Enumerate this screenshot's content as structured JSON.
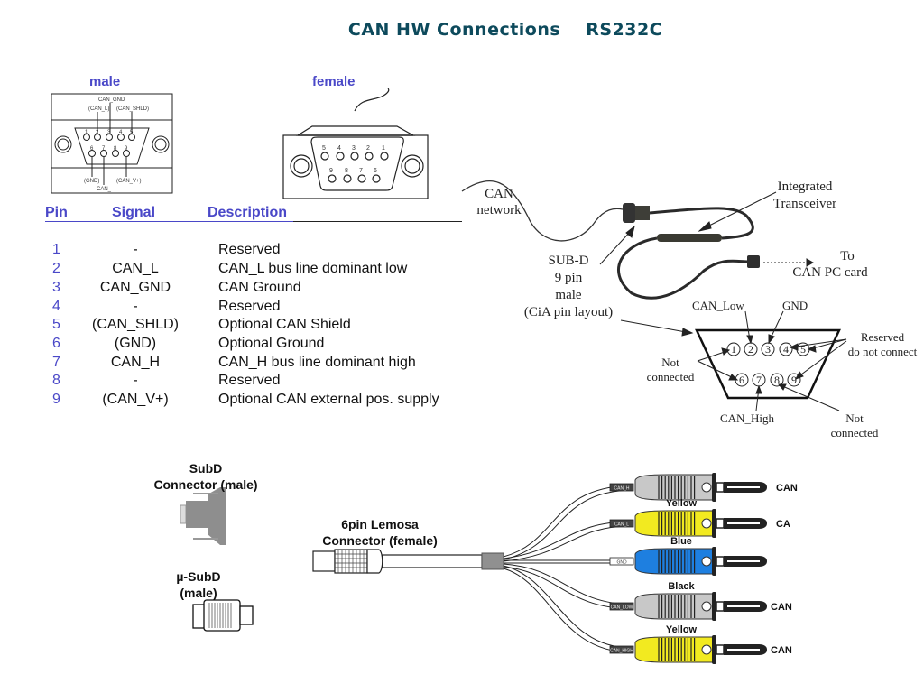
{
  "title": {
    "main": "CAN HW Connections",
    "sub": "RS232C"
  },
  "connectors": {
    "male": {
      "label": "male",
      "pin_labels_top": [
        "CAN_GND",
        "(CAN_L)",
        "(CAN_SHLD)"
      ],
      "pin_labels_bottom": [
        "(GND)",
        "CAN_",
        "(CAN_V+)"
      ],
      "pins_top": [
        "1",
        "2",
        "3",
        "4",
        "5"
      ],
      "pins_bottom": [
        "6",
        "7",
        "8",
        "9"
      ]
    },
    "female": {
      "label": "female",
      "pins_top": [
        "5",
        "4",
        "3",
        "2",
        "1"
      ],
      "pins_bottom": [
        "9",
        "8",
        "7",
        "6"
      ]
    }
  },
  "pin_table": {
    "headers": {
      "pin": "Pin",
      "signal": "Signal",
      "description": "Description"
    },
    "rows": [
      {
        "pin": "1",
        "signal": "-",
        "description": "Reserved"
      },
      {
        "pin": "2",
        "signal": "CAN_L",
        "description": "CAN_L bus line dominant low"
      },
      {
        "pin": "3",
        "signal": "CAN_GND",
        "description": "CAN Ground"
      },
      {
        "pin": "4",
        "signal": "-",
        "description": "Reserved"
      },
      {
        "pin": "5",
        "signal": "(CAN_SHLD)",
        "description": "Optional CAN Shield"
      },
      {
        "pin": "6",
        "signal": "(GND)",
        "description": "Optional Ground"
      },
      {
        "pin": "7",
        "signal": "CAN_H",
        "description": "CAN_H bus line dominant high"
      },
      {
        "pin": "8",
        "signal": "-",
        "description": "Reserved"
      },
      {
        "pin": "9",
        "signal": "(CAN_V+)",
        "description": "Optional CAN external pos. supply"
      }
    ]
  },
  "cable_diagram": {
    "can_network": [
      "CAN",
      "network"
    ],
    "integrated_transceiver": [
      "Integrated",
      "Transceiver"
    ],
    "to_pc": [
      "To",
      "CAN PC card"
    ],
    "subd": [
      "SUB-D",
      "9 pin",
      "male",
      "(CiA pin layout)"
    ],
    "can_low": "CAN_Low",
    "gnd": "GND",
    "reserved": [
      "Reserved",
      "do not connect"
    ],
    "not_connected_left": [
      "Not",
      "connected"
    ],
    "not_connected_right": [
      "Not",
      "connected"
    ],
    "can_high": "CAN_High",
    "pins_top": [
      "1",
      "2",
      "3",
      "4",
      "5"
    ],
    "pins_bottom": [
      "6",
      "7",
      "8",
      "9"
    ]
  },
  "adapters": {
    "subd": [
      "SubD",
      "Connector (male)"
    ],
    "micro_subd": [
      "µ-SubD",
      "(male)"
    ],
    "lemosa": [
      "6pin Lemosa",
      "Connector (female)"
    ]
  },
  "plugs": [
    {
      "color_label": "",
      "tag": "CAN_H",
      "end_label": "CAN",
      "color": "#c8c8c8"
    },
    {
      "color_label": "Yellow",
      "tag": "CAN_L",
      "end_label": "CA",
      "color": "#f2ea20"
    },
    {
      "color_label": "Blue",
      "tag": "GND",
      "end_label": "",
      "color": "#1e7fe0"
    },
    {
      "color_label": "Black",
      "tag": "CAN_LOW",
      "end_label": "CAN",
      "color": "#c8c8c8"
    },
    {
      "color_label": "Yellow",
      "tag": "CAN_HIGH",
      "end_label": "CAN",
      "color": "#f2ea20"
    }
  ]
}
